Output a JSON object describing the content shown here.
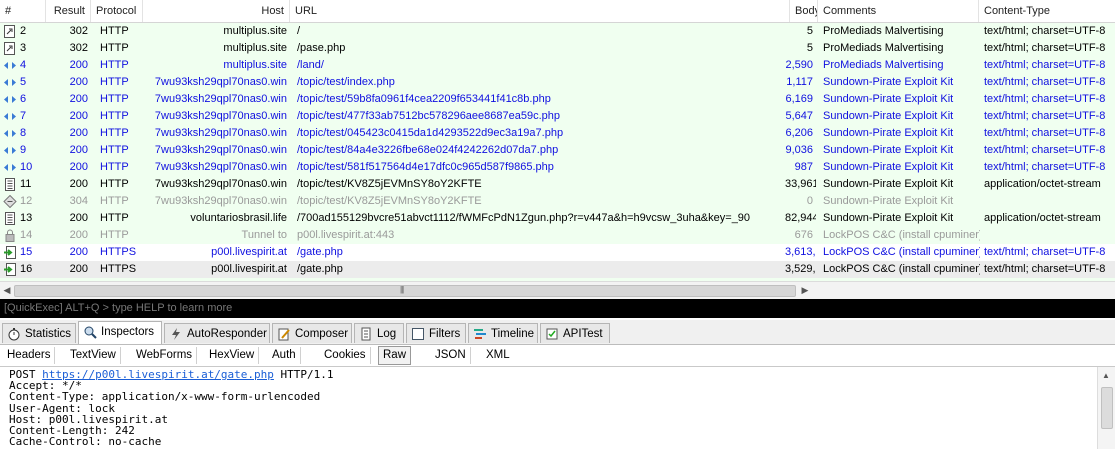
{
  "columns": [
    "#",
    "Result",
    "Protocol",
    "Host",
    "URL",
    "Body",
    "Comments",
    "Content-Type"
  ],
  "sessions": [
    {
      "num": "2",
      "result": "302",
      "protocol": "HTTP",
      "host": "multiplus.site",
      "url": "/",
      "body": "5",
      "comment": "ProMediads Malvertising",
      "ctype": "text/html; charset=UTF-8",
      "color": "black",
      "bg": "green",
      "icon": "page-icon"
    },
    {
      "num": "3",
      "result": "302",
      "protocol": "HTTP",
      "host": "multiplus.site",
      "url": "/pase.php",
      "body": "5",
      "comment": "ProMediads Malvertising",
      "ctype": "text/html; charset=UTF-8",
      "color": "black",
      "bg": "green",
      "icon": "page-icon"
    },
    {
      "num": "4",
      "result": "200",
      "protocol": "HTTP",
      "host": "multiplus.site",
      "url": "/land/",
      "body": "2,590",
      "comment": "ProMediads Malvertising",
      "ctype": "text/html; charset=UTF-8",
      "color": "blue",
      "bg": "green",
      "icon": "html-icon"
    },
    {
      "num": "5",
      "result": "200",
      "protocol": "HTTP",
      "host": "7wu93ksh29qpl70nas0.win",
      "url": "/topic/test/index.php",
      "body": "1,117",
      "comment": "Sundown-Pirate Exploit Kit",
      "ctype": "text/html; charset=UTF-8",
      "color": "blue",
      "bg": "green",
      "icon": "html-icon"
    },
    {
      "num": "6",
      "result": "200",
      "protocol": "HTTP",
      "host": "7wu93ksh29qpl70nas0.win",
      "url": "/topic/test/59b8fa0961f4cea2209f653441f41c8b.php",
      "body": "6,169",
      "comment": "Sundown-Pirate Exploit Kit",
      "ctype": "text/html; charset=UTF-8",
      "color": "blue",
      "bg": "green",
      "icon": "html-icon"
    },
    {
      "num": "7",
      "result": "200",
      "protocol": "HTTP",
      "host": "7wu93ksh29qpl70nas0.win",
      "url": "/topic/test/477f33ab7512bc578296aee8687ea59c.php",
      "body": "5,647",
      "comment": "Sundown-Pirate Exploit Kit",
      "ctype": "text/html; charset=UTF-8",
      "color": "blue",
      "bg": "green",
      "icon": "html-icon"
    },
    {
      "num": "8",
      "result": "200",
      "protocol": "HTTP",
      "host": "7wu93ksh29qpl70nas0.win",
      "url": "/topic/test/045423c0415da1d4293522d9ec3a19a7.php",
      "body": "6,206",
      "comment": "Sundown-Pirate Exploit Kit",
      "ctype": "text/html; charset=UTF-8",
      "color": "blue",
      "bg": "green",
      "icon": "html-icon"
    },
    {
      "num": "9",
      "result": "200",
      "protocol": "HTTP",
      "host": "7wu93ksh29qpl70nas0.win",
      "url": "/topic/test/84a4e3226fbe68e024f4242262d07da7.php",
      "body": "9,036",
      "comment": "Sundown-Pirate Exploit Kit",
      "ctype": "text/html; charset=UTF-8",
      "color": "blue",
      "bg": "green",
      "icon": "html-icon"
    },
    {
      "num": "10",
      "result": "200",
      "protocol": "HTTP",
      "host": "7wu93ksh29qpl70nas0.win",
      "url": "/topic/test/581f517564d4e17dfc0c965d587f9865.php",
      "body": "987",
      "comment": "Sundown-Pirate Exploit Kit",
      "ctype": "text/html; charset=UTF-8",
      "color": "blue",
      "bg": "green",
      "icon": "html-icon"
    },
    {
      "num": "11",
      "result": "200",
      "protocol": "HTTP",
      "host": "7wu93ksh29qpl70nas0.win",
      "url": "/topic/test/KV8Z5jEVMnSY8oY2KFTE",
      "body": "33,961",
      "comment": "Sundown-Pirate Exploit Kit",
      "ctype": "application/octet-stream",
      "color": "black",
      "bg": "green",
      "icon": "binary-icon"
    },
    {
      "num": "12",
      "result": "304",
      "protocol": "HTTP",
      "host": "7wu93ksh29qpl70nas0.win",
      "url": "/topic/test/KV8Z5jEVMnSY8oY2KFTE",
      "body": "0",
      "comment": "Sundown-Pirate Exploit Kit",
      "ctype": "",
      "color": "gray",
      "bg": "green",
      "icon": "not-modified-icon"
    },
    {
      "num": "13",
      "result": "200",
      "protocol": "HTTP",
      "host": "voluntariosbrasil.life",
      "url": "/700ad155129bvcre51abvct1112/fWMFcPdN1Zgun.php?r=v447a&h=h9vcsw_3uha&key=_90",
      "body": "82,944",
      "comment": "Sundown-Pirate Exploit Kit",
      "ctype": "application/octet-stream",
      "color": "black",
      "bg": "green",
      "icon": "binary-icon"
    },
    {
      "num": "14",
      "result": "200",
      "protocol": "HTTP",
      "host": "Tunnel to",
      "url": "p00l.livespirit.at:443",
      "body": "676",
      "comment": "LockPOS C&C (install cpuminer)",
      "ctype": "",
      "color": "gray",
      "bg": "green",
      "icon": "lock-icon"
    },
    {
      "num": "15",
      "result": "200",
      "protocol": "HTTPS",
      "host": "p00l.livespirit.at",
      "url": "/gate.php",
      "body": "3,613,748",
      "comment": "LockPOS C&C (install cpuminer)",
      "ctype": "text/html; charset=UTF-8",
      "color": "blue",
      "bg": "white",
      "icon": "arrow-page-icon"
    },
    {
      "num": "16",
      "result": "200",
      "protocol": "HTTPS",
      "host": "p00l.livespirit.at",
      "url": "/gate.php",
      "body": "3,529,367",
      "comment": "LockPOS C&C (install cpuminer)",
      "ctype": "text/html; charset=UTF-8",
      "color": "black",
      "bg": "selected",
      "icon": "arrow-page-icon"
    }
  ],
  "quickexec": "[QuickExec] ALT+Q > type HELP to learn more",
  "tabs": [
    "Statistics",
    "Inspectors",
    "AutoResponder",
    "Composer",
    "Log",
    "Filters",
    "Timeline",
    "APITest"
  ],
  "active_tab": "Inspectors",
  "subtabs": [
    "Headers",
    "TextView",
    "WebForms",
    "HexView",
    "Auth",
    "Cookies",
    "Raw",
    "JSON",
    "XML"
  ],
  "active_subtab": "Raw",
  "request": {
    "method": "POST",
    "url": "https://p00l.livespirit.at/gate.php",
    "version": "HTTP/1.1",
    "headers": [
      "Accept: */*",
      "Content-Type: application/x-www-form-urlencoded",
      "User-Agent: lock",
      "Host: p00l.livespirit.at",
      "Content-Length: 242",
      "Cache-Control: no-cache"
    ]
  },
  "colors": {
    "row_green": "#f0fff0",
    "link_blue": "#1010e0",
    "muted": "#9a9a9a",
    "selected": "#ececec"
  }
}
